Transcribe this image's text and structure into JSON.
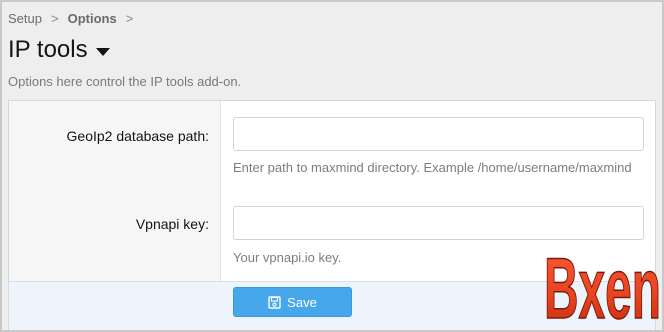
{
  "breadcrumb": {
    "items": [
      "Setup",
      "Options"
    ],
    "separator": ">"
  },
  "page": {
    "title": "IP tools",
    "description": "Options here control the IP tools add-on."
  },
  "form": {
    "fields": [
      {
        "label": "GeoIp2 database path:",
        "value": "",
        "hint": "Enter path to maxmind directory. Example /home/username/maxmind"
      },
      {
        "label": "Vpnapi key:",
        "value": "",
        "hint": "Your vpnapi.io key."
      }
    ],
    "save_label": "Save",
    "save_icon": "save-icon"
  },
  "watermark": {
    "text": "Bxen"
  },
  "colors": {
    "accent": "#47a7eb",
    "footer_bg": "#edf4fb",
    "page_bg": "#eeeeee"
  }
}
